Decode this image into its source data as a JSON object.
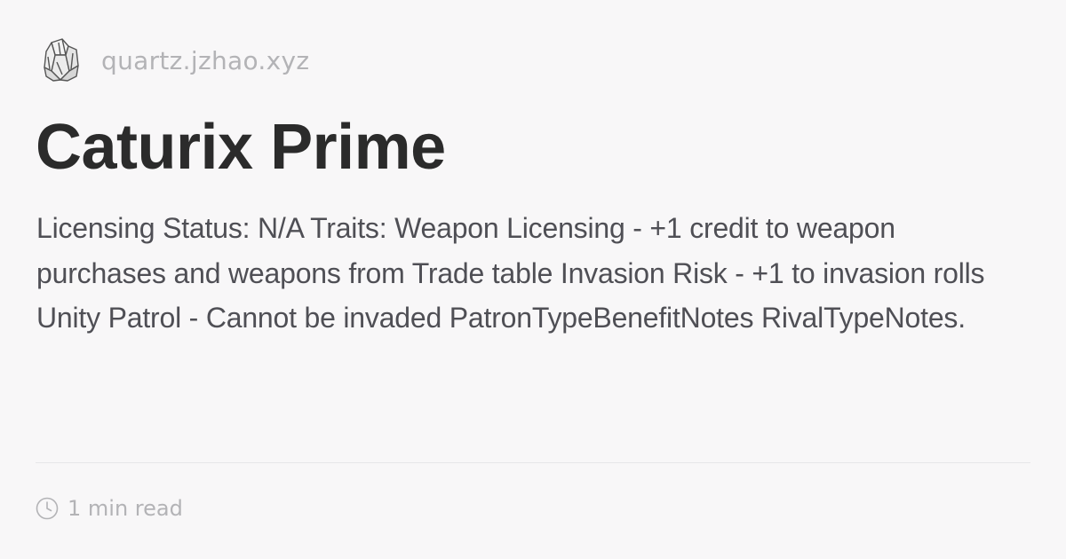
{
  "site": {
    "logo_icon": "crystal-logo-icon",
    "name": "quartz.jzhao.xyz"
  },
  "page": {
    "title": "Caturix Prime",
    "description": "Licensing Status: N/A Traits: Weapon Licensing - +1 credit to weapon purchases and weapons from Trade table Invasion Risk - +1 to invasion rolls Unity Patrol - Cannot be invaded PatronTypeBenefitNotes RivalTypeNotes."
  },
  "meta": {
    "clock_icon": "clock-icon",
    "read_time": "1 min read"
  },
  "colors": {
    "background": "#f8f7f8",
    "title": "#2b2b2b",
    "body_text": "#4f4f55",
    "muted": "#b3b3b6",
    "divider": "#e6e6e9"
  }
}
